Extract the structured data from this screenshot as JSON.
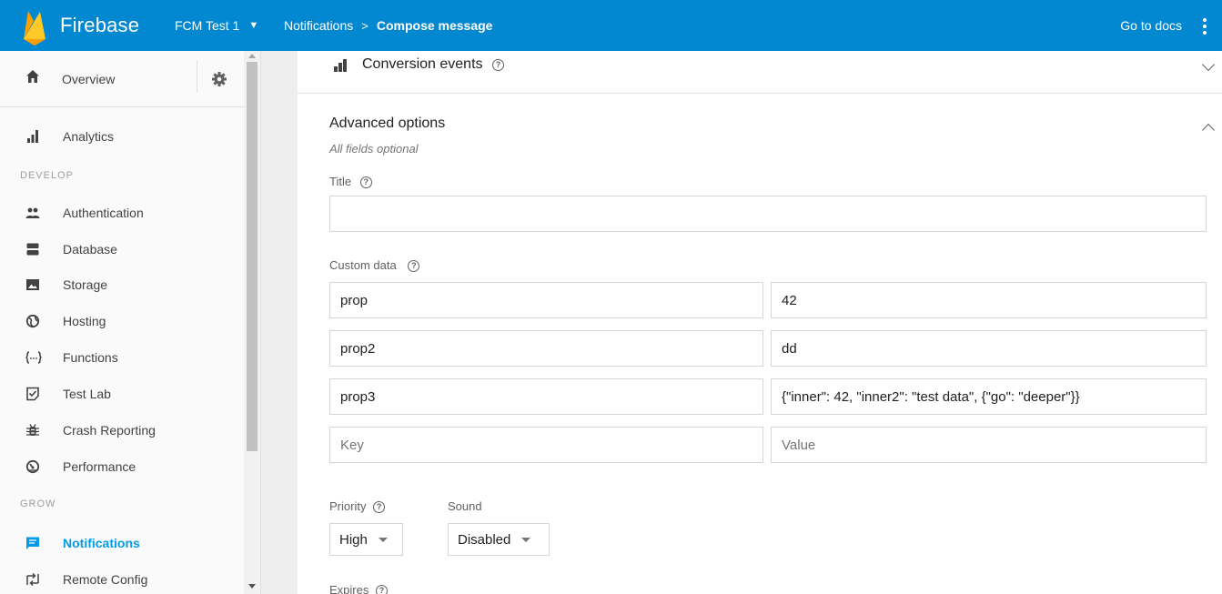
{
  "topbar": {
    "brand": "Firebase",
    "project": "FCM Test 1",
    "breadcrumb_parent": "Notifications",
    "breadcrumb_current": "Compose message",
    "docs_link": "Go to docs",
    "background": "#0288d1"
  },
  "sidebar": {
    "overview": "Overview",
    "analytics": "Analytics",
    "section_develop": "DEVELOP",
    "develop_items": [
      "Authentication",
      "Database",
      "Storage",
      "Hosting",
      "Functions",
      "Test Lab",
      "Crash Reporting",
      "Performance"
    ],
    "section_grow": "GROW",
    "grow_items": [
      "Notifications",
      "Remote Config"
    ],
    "active_item": "Notifications",
    "active_color": "#039be5",
    "icons": [
      "home-icon",
      "settings-gear-icon",
      "analytics-bar-icon",
      "people-icon",
      "database-icon",
      "image-icon",
      "globe-icon",
      "braces-icon",
      "checklist-icon",
      "bug-icon",
      "speedometer-icon",
      "message-icon",
      "remote-config-icon"
    ]
  },
  "main": {
    "conversion_events": "Conversion events",
    "advanced_options": "Advanced options",
    "all_fields_optional": "All fields optional",
    "title_label": "Title",
    "title_value": "",
    "custom_data_label": "Custom data",
    "custom_data": [
      {
        "key": "prop",
        "value": "42"
      },
      {
        "key": "prop2",
        "value": "dd"
      },
      {
        "key": "prop3",
        "value": "{\"inner\": 42, \"inner2\": \"test data\", {\"go\": \"deeper\"}}"
      }
    ],
    "key_placeholder": "Key",
    "value_placeholder": "Value",
    "priority_label": "Priority",
    "priority_value": "High",
    "sound_label": "Sound",
    "sound_value": "Disabled",
    "expires_label": "Expires",
    "help_glyph": "?"
  }
}
